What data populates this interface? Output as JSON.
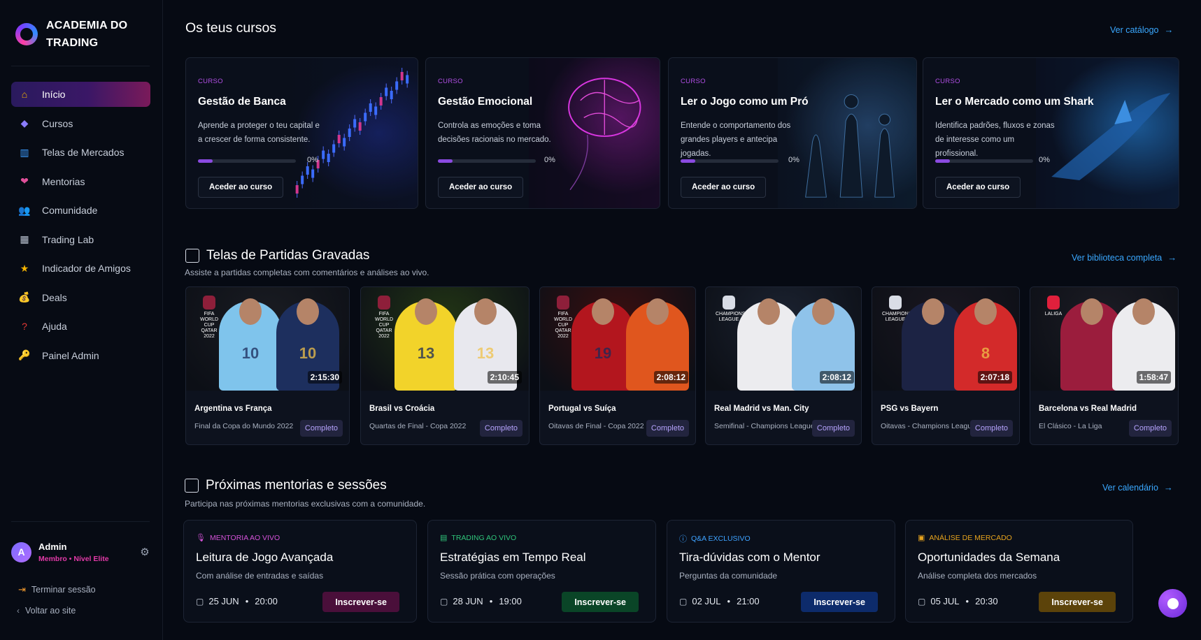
{
  "brand": {
    "name_line1": "ACADEMIA DO",
    "name_line2": "TRADING"
  },
  "sidebar": {
    "items": [
      {
        "label": "Início",
        "icon": "home-icon",
        "color": "#f5b400",
        "glyph": "⌂"
      },
      {
        "label": "Cursos",
        "icon": "cube-icon",
        "color": "#8a7cff",
        "glyph": "◆"
      },
      {
        "label": "Telas de Mercados",
        "icon": "bar-chart-icon",
        "color": "#3b9cff",
        "glyph": "▥"
      },
      {
        "label": "Mentorias",
        "icon": "heart-badge-icon",
        "color": "#e0509a",
        "glyph": "❤"
      },
      {
        "label": "Comunidade",
        "icon": "users-icon",
        "color": "#8a7cff",
        "glyph": "👥"
      },
      {
        "label": "Trading Lab",
        "icon": "trading-lab-icon",
        "color": "#b9c2d0",
        "glyph": "▦"
      },
      {
        "label": "Indicador de Amigos",
        "icon": "star-icon",
        "color": "#f5b400",
        "glyph": "★"
      },
      {
        "label": "Deals",
        "icon": "money-bag-icon",
        "color": "#d99a3a",
        "glyph": "💰"
      },
      {
        "label": "Ajuda",
        "icon": "question-icon",
        "color": "#e53935",
        "glyph": "?"
      },
      {
        "label": "Painel Admin",
        "icon": "key-icon",
        "color": "#f5b400",
        "glyph": "🔑"
      }
    ],
    "user": {
      "initial": "A",
      "name": "Admin",
      "role_prefix": "Membro",
      "role_sep": "•",
      "role_level": "Nível Elite"
    },
    "logout_label": "Terminar sessão",
    "back_label": "Voltar ao site"
  },
  "courses_section": {
    "title": "Os teus cursos",
    "link": "Ver catálogo",
    "items": [
      {
        "tag": "CURSO",
        "title": "Gestão de Banca",
        "desc": "Aprende a proteger o teu capital e a crescer de forma consistente.",
        "progress": 0.15,
        "pct": "0%",
        "button": "Aceder ao curso",
        "art": "candlestick"
      },
      {
        "tag": "CURSO",
        "title": "Gestão Emocional",
        "desc": "Controla as emoções e toma decisões racionais no mercado.",
        "progress": 0.15,
        "pct": "0%",
        "button": "Aceder ao curso",
        "art": "brain"
      },
      {
        "tag": "CURSO",
        "title": "Ler o Jogo como um Pró",
        "desc": "Entende o comportamento dos grandes players e antecipa jogadas.",
        "progress": 0.15,
        "pct": "0%",
        "button": "Aceder ao curso",
        "art": "chess"
      },
      {
        "tag": "CURSO",
        "title": "Ler o Mercado como um Shark",
        "desc": "Identifica padrões, fluxos e zonas de interesse como um profissional.",
        "progress": 0.15,
        "pct": "0%",
        "button": "Aceder ao curso",
        "art": "shark"
      }
    ]
  },
  "matches_section": {
    "title": "Telas de Partidas Gravadas",
    "subtitle": "Assiste a partidas completas com comentários e análises ao vivo.",
    "link": "Ver biblioteca completa",
    "items": [
      {
        "title": "Argentina vs França",
        "sub": "Final da Copa do Mundo 2022",
        "duration": "2:15:30",
        "badge": "Completo",
        "crest": "FIFA WORLD CUP QATAR 2022",
        "bg": "#1a1c22",
        "p1": "#7fc4ec",
        "p2": "#1d2f5e",
        "n1": "10",
        "n2": "10"
      },
      {
        "title": "Brasil vs Croácia",
        "sub": "Quartas de Final - Copa 2022",
        "duration": "2:10:45",
        "badge": "Completo",
        "crest": "FIFA WORLD CUP QATAR 2022",
        "bg": "#223515",
        "p1": "#f2d32a",
        "p2": "#e8e8ee",
        "n1": "13",
        "n2": "13"
      },
      {
        "title": "Portugal vs Suíça",
        "sub": "Oitavas de Final - Copa 2022",
        "duration": "2:08:12",
        "badge": "Completo",
        "crest": "FIFA WORLD CUP QATAR 2022",
        "bg": "#3a0f10",
        "p1": "#b3161e",
        "p2": "#e0561e",
        "n1": "19",
        "n2": ""
      },
      {
        "title": "Real Madrid vs Man. City",
        "sub": "Semifinal - Champions League",
        "duration": "2:08:12",
        "badge": "Completo",
        "crest": "CHAMPIONS LEAGUE",
        "bg": "#1b2230",
        "p1": "#ececef",
        "p2": "#8fc3ea",
        "n1": "",
        "n2": ""
      },
      {
        "title": "PSG vs Bayern",
        "sub": "Oitavas - Champions League",
        "duration": "2:07:18",
        "badge": "Completo",
        "crest": "CHAMPIONS LEAGUE",
        "bg": "#1a1720",
        "p1": "#1c2344",
        "p2": "#d32a2a",
        "n1": "",
        "n2": "8"
      },
      {
        "title": "Barcelona vs Real Madrid",
        "sub": "El Clásico - La Liga",
        "duration": "1:58:47",
        "badge": "Completo",
        "crest": "LALIGA",
        "bg": "#1c1c24",
        "p1": "#9b1d3d",
        "p2": "#ececef",
        "n1": "",
        "n2": ""
      }
    ]
  },
  "sessions_section": {
    "title": "Próximas mentorias e sessões",
    "subtitle": "Participa nas próximas mentorias exclusivas com a comunidade.",
    "link": "Ver calendário",
    "items": [
      {
        "tag": "MENTORIA AO VIVO",
        "tag_color": "#d452d8",
        "icon": "mic-icon",
        "title": "Leitura de Jogo Avançada",
        "sub": "Com análise de entradas e saídas",
        "date": "25 JUN",
        "time": "20:00",
        "button": "Inscrever-se",
        "btn_color": "#4a0f3a"
      },
      {
        "tag": "TRADING AO VIVO",
        "tag_color": "#2fc47a",
        "icon": "chart-icon",
        "title": "Estratégias em Tempo Real",
        "sub": "Sessão prática com operações",
        "date": "28 JUN",
        "time": "19:00",
        "button": "Inscrever-se",
        "btn_color": "#0a4527"
      },
      {
        "tag": "Q&A EXCLUSIVO",
        "tag_color": "#3ea2ff",
        "icon": "info-icon",
        "title": "Tira-dúvidas com o Mentor",
        "sub": "Perguntas da comunidade",
        "date": "02 JUL",
        "time": "21:00",
        "button": "Inscrever-se",
        "btn_color": "#0d2b6b"
      },
      {
        "tag": "ANÁLISE DE MERCADO",
        "tag_color": "#e5a21d",
        "icon": "analysis-icon",
        "title": "Oportunidades da Semana",
        "sub": "Análise completa dos mercados",
        "date": "05 JUL",
        "time": "20:30",
        "button": "Inscrever-se",
        "btn_color": "#5c430a"
      }
    ]
  }
}
